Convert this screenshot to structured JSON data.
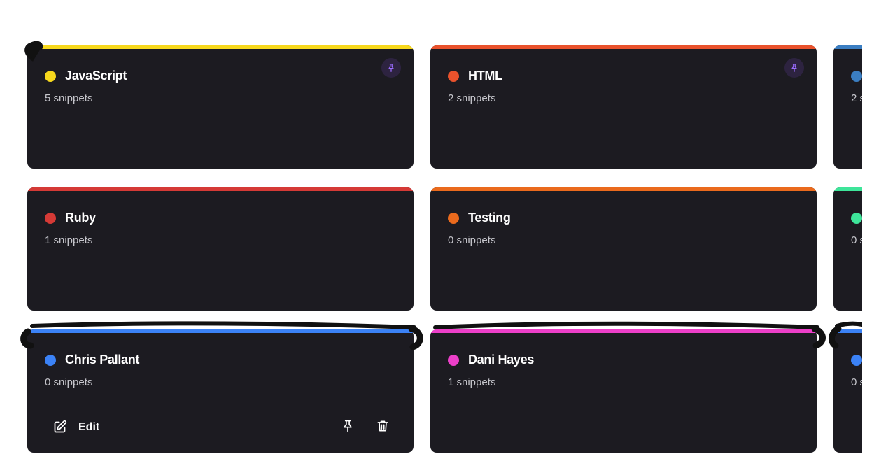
{
  "colors": {
    "card_bg": "#1c1b21",
    "pin_badge_bg": "#2d2340",
    "pin_icon": "#9b6cff"
  },
  "cards": [
    {
      "title": "JavaScript",
      "count": "5 snippets",
      "color": "#f7d81c",
      "pinned": true
    },
    {
      "title": "HTML",
      "count": "2 snippets",
      "color": "#e9522c",
      "pinned": true
    },
    {
      "title": "",
      "count": "2 s",
      "color": "#3b7ec2",
      "pinned": false
    },
    {
      "title": "Ruby",
      "count": "1 snippets",
      "color": "#d53a36",
      "pinned": false
    },
    {
      "title": "Testing",
      "count": "0 snippets",
      "color": "#ea6a1d",
      "pinned": false
    },
    {
      "title": "",
      "count": "0 s",
      "color": "#3ee59a",
      "pinned": false
    },
    {
      "title": "Chris Pallant",
      "count": "0 snippets",
      "color": "#3b82f6",
      "pinned": false
    },
    {
      "title": "Dani Hayes",
      "count": "1 snippets",
      "color": "#ec3fc9",
      "pinned": false
    },
    {
      "title": "",
      "count": "0 s",
      "color": "#3b82f6",
      "pinned": false
    }
  ],
  "actions": {
    "edit_label": "Edit",
    "edit_icon": "pencil-square-icon",
    "pin_icon": "pin-icon",
    "delete_icon": "trash-icon"
  }
}
